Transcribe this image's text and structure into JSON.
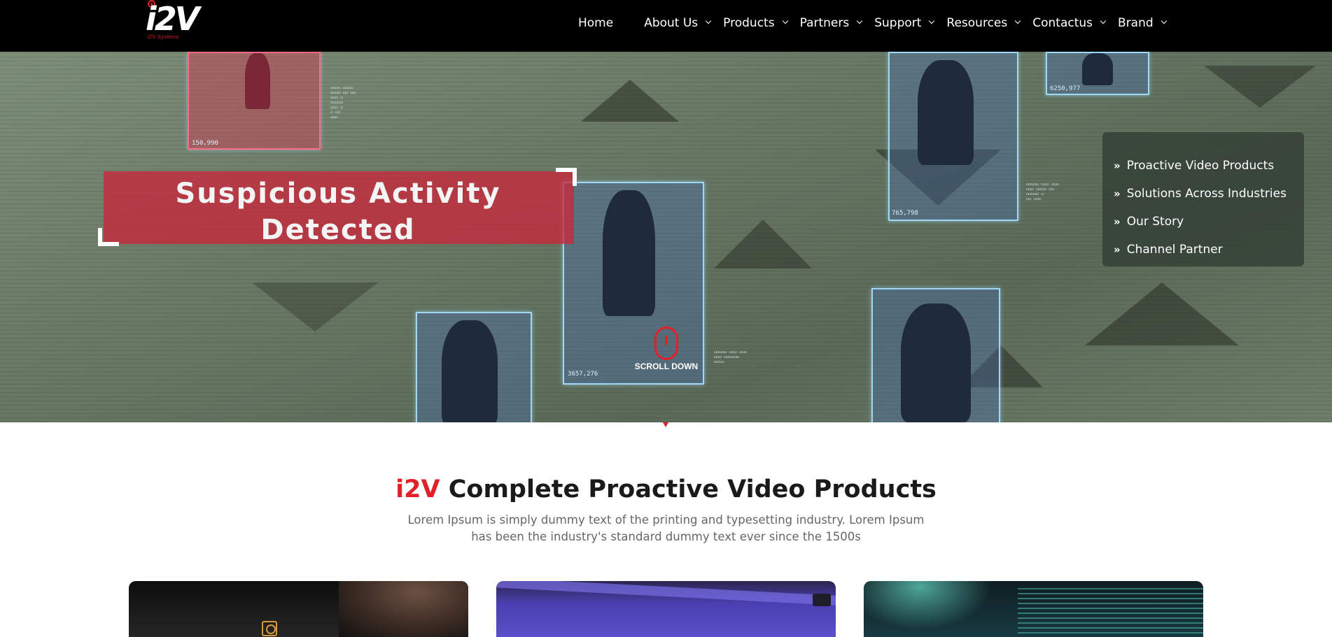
{
  "logo": {
    "text": "i2V",
    "subtext": "i2V Systems"
  },
  "nav": {
    "items": [
      {
        "label": "Home",
        "has_dropdown": false
      },
      {
        "label": "About Us",
        "has_dropdown": true
      },
      {
        "label": "Products",
        "has_dropdown": true
      },
      {
        "label": "Partners",
        "has_dropdown": true
      },
      {
        "label": "Support",
        "has_dropdown": true
      },
      {
        "label": "Resources",
        "has_dropdown": true
      },
      {
        "label": "Contactus",
        "has_dropdown": true
      },
      {
        "label": "Brand",
        "has_dropdown": true
      }
    ]
  },
  "hero": {
    "alert_text": "Suspicious Activity Detected",
    "detection_ids": [
      "150,990",
      "765,798",
      "6250,977",
      "3657,276"
    ],
    "quick_links": [
      {
        "label": "Proactive Video Products",
        "icon": "double-chevron-right-icon"
      },
      {
        "label": "Solutions Across Industries",
        "icon": "double-chevron-right-icon"
      },
      {
        "label": "Our Story",
        "icon": "double-chevron-right-icon"
      },
      {
        "label": "Channel Partner",
        "icon": "double-chevron-right-icon"
      }
    ],
    "scroll_label": "SCROLL DOWN"
  },
  "products_section": {
    "title_brand": "i2V",
    "title_rest": "Complete Proactive Video Products",
    "description": "Lorem Ipsum is simply dummy text of the printing and typesetting industry. Lorem Ipsum has been the industry's standard dummy text ever since the 1500s"
  },
  "colors": {
    "accent": "#e32027",
    "nav_bg": "#000000",
    "hud_blue": "#9fd8f5"
  }
}
